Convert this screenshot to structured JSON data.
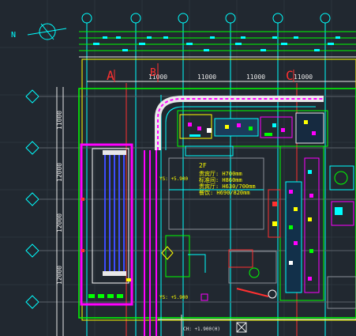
{
  "drawing": {
    "background": "#212830",
    "compass_label": "N",
    "dim_labels": [
      "11000",
      "11000",
      "11000",
      "11000"
    ],
    "left_dims": [
      "11000",
      "12000",
      "12000",
      "12000"
    ],
    "grid_letters": [
      "A",
      "B",
      "C"
    ],
    "notes": {
      "title": "2F",
      "lines": [
        "贵宾厅: H700mm",
        "标准间: H860mm",
        "贵宾厅: H630/700mm",
        "餐饮: H690/820mm"
      ]
    },
    "tags": [
      "YS: +5.900",
      "YS: +5.900",
      "CH: +1.900(H)"
    ],
    "colors": {
      "cyan": "#00ffff",
      "green": "#00ff00",
      "magenta": "#ff00ff",
      "yellow": "#ffff00",
      "red": "#ff3030",
      "blue": "#3c4cff",
      "white": "#e8e8e8",
      "grey": "#8a9098"
    }
  }
}
